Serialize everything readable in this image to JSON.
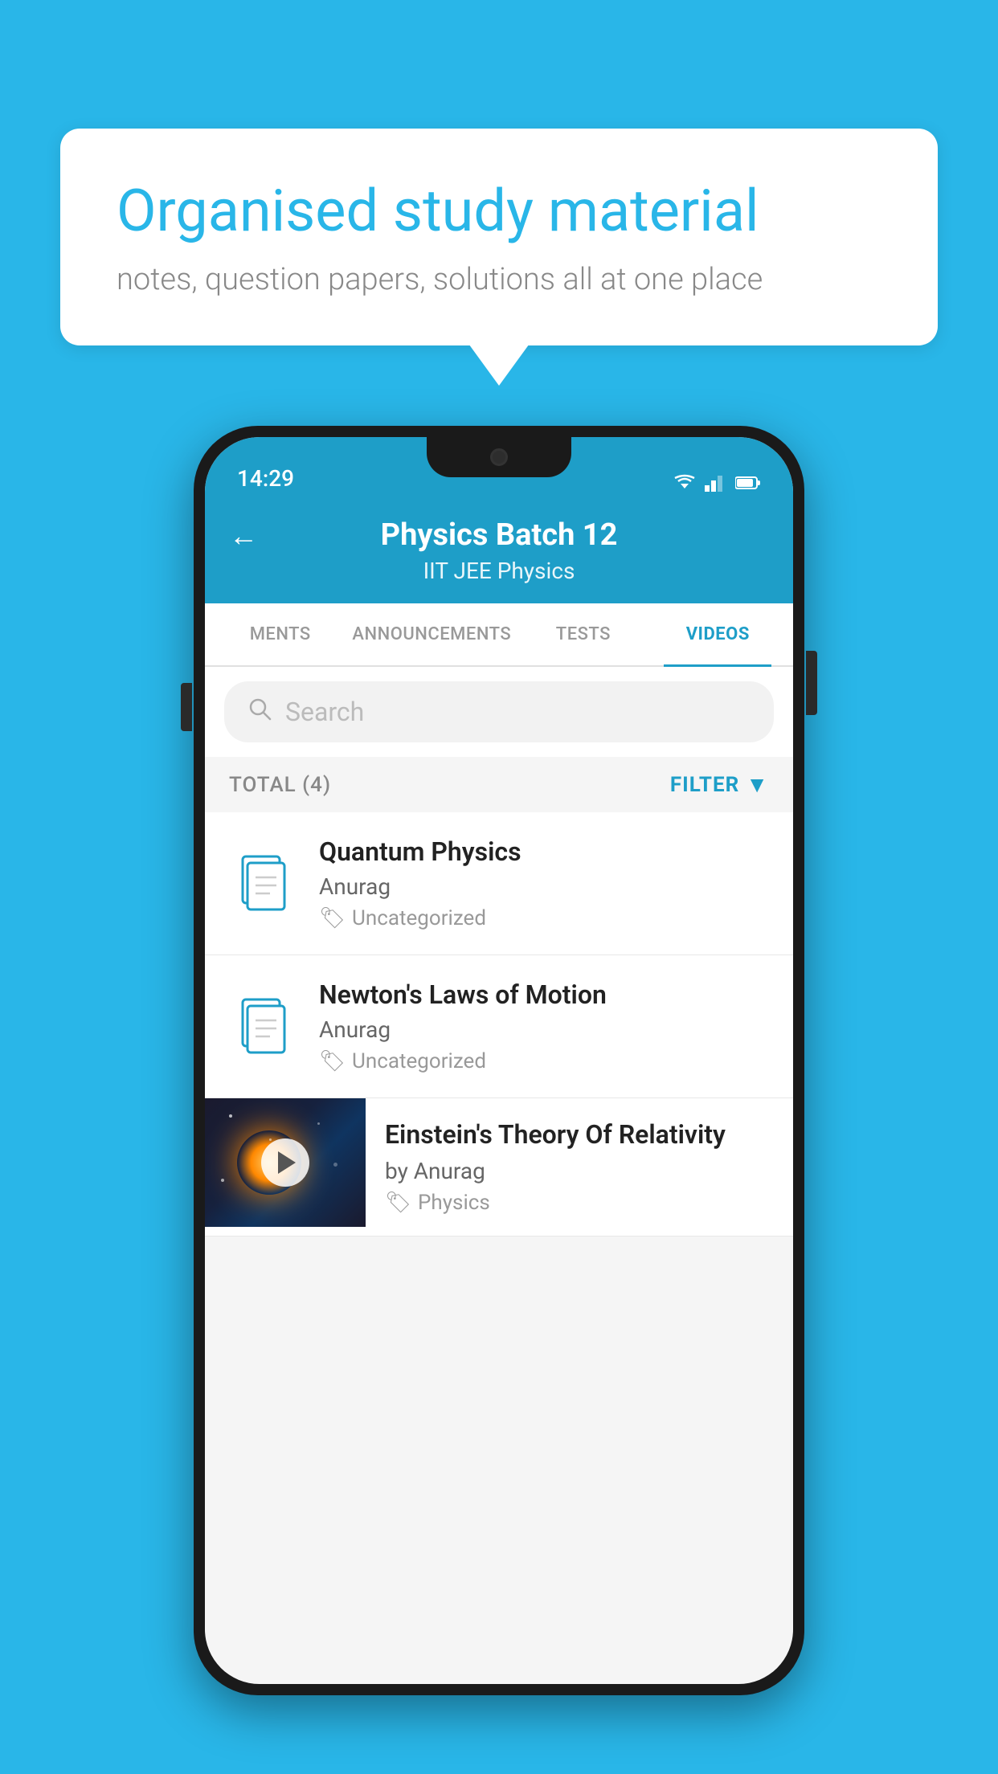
{
  "background_color": "#29b6e8",
  "bubble": {
    "title": "Organised study material",
    "subtitle": "notes, question papers, solutions all at one place"
  },
  "phone": {
    "status_bar": {
      "time": "14:29"
    },
    "header": {
      "title": "Physics Batch 12",
      "subtitle": "IIT JEE   Physics",
      "back_label": "←"
    },
    "tabs": [
      {
        "label": "MENTS",
        "active": false
      },
      {
        "label": "ANNOUNCEMENTS",
        "active": false
      },
      {
        "label": "TESTS",
        "active": false
      },
      {
        "label": "VIDEOS",
        "active": true
      }
    ],
    "search": {
      "placeholder": "Search"
    },
    "filter_bar": {
      "total_label": "TOTAL (4)",
      "filter_label": "FILTER"
    },
    "videos": [
      {
        "title": "Quantum Physics",
        "author": "Anurag",
        "tag": "Uncategorized",
        "has_thumb": false
      },
      {
        "title": "Newton's Laws of Motion",
        "author": "Anurag",
        "tag": "Uncategorized",
        "has_thumb": false
      },
      {
        "title": "Einstein's Theory Of Relativity",
        "author": "by Anurag",
        "tag": "Physics",
        "has_thumb": true
      }
    ]
  }
}
